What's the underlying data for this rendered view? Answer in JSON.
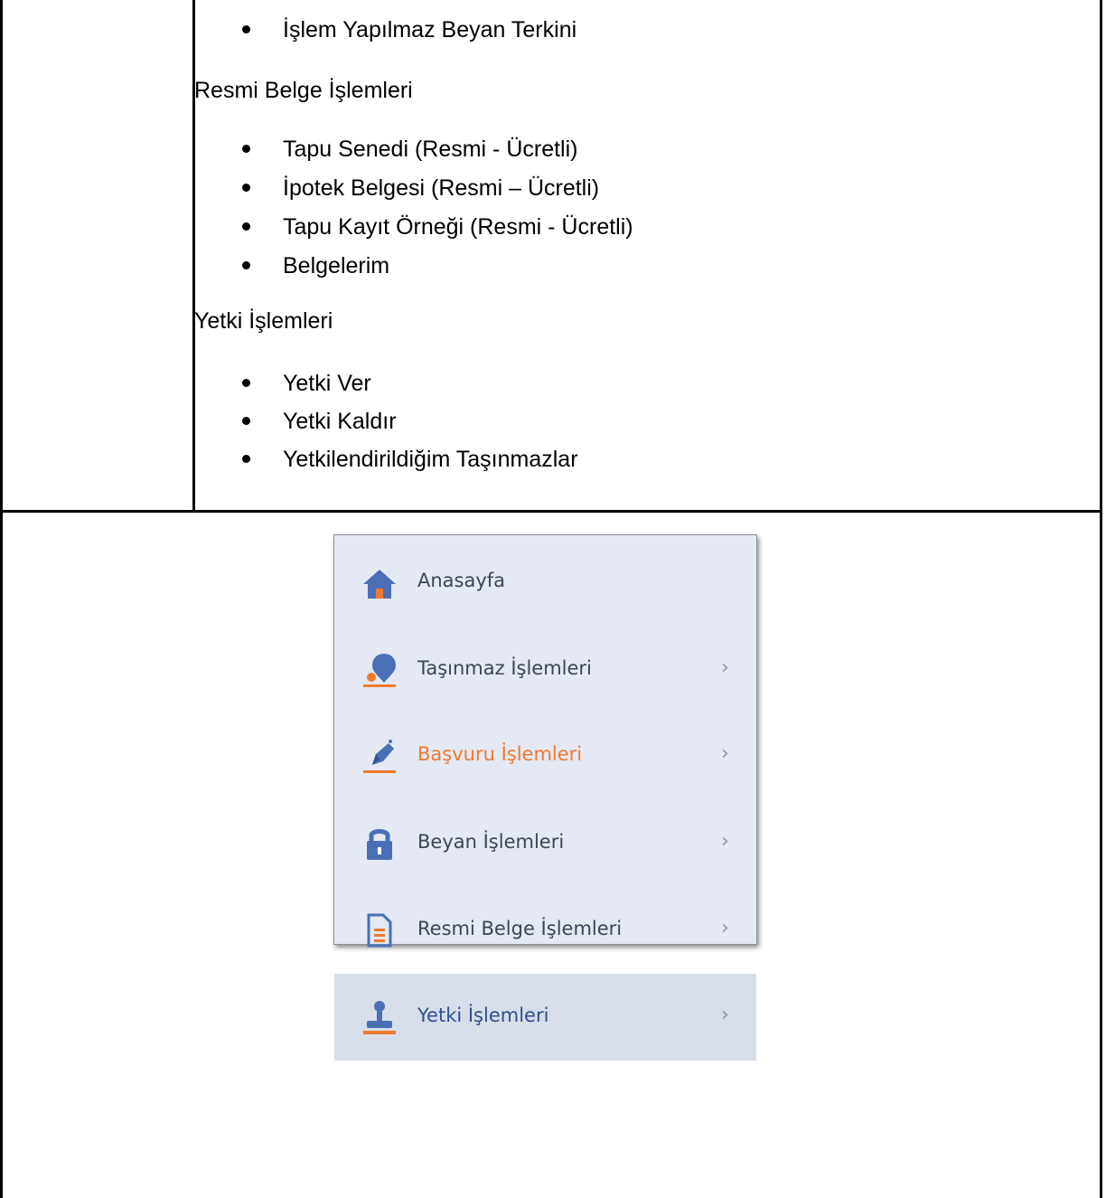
{
  "top_list": {
    "first_item": "İşlem Yapılmaz Beyan Terkini"
  },
  "resmi_belge": {
    "heading": "Resmi Belge İşlemleri",
    "items": [
      "Tapu Senedi (Resmi - Ücretli)",
      "İpotek Belgesi (Resmi – Ücretli)",
      "Tapu Kayıt Örneği (Resmi - Ücretli)",
      "Belgelerim"
    ]
  },
  "yetki": {
    "heading": "Yetki İşlemleri",
    "items": [
      "Yetki Ver",
      "Yetki Kaldır",
      "Yetkilendirildiğim Taşınmazlar"
    ]
  },
  "menu": {
    "chevron": "›",
    "items": [
      {
        "label": "Anasayfa",
        "icon": "home-icon"
      },
      {
        "label": "Taşınmaz İşlemleri",
        "icon": "map-pin-icon"
      },
      {
        "label": "Başvuru İşlemleri",
        "icon": "pen-icon"
      },
      {
        "label": "Beyan İşlemleri",
        "icon": "lock-icon"
      },
      {
        "label": "Resmi Belge İşlemleri",
        "icon": "document-icon"
      },
      {
        "label": "Yetki İşlemleri",
        "icon": "stamp-icon"
      }
    ]
  },
  "colors": {
    "icon_blue": "#4a6fb5",
    "accent_orange": "#ee7a2f",
    "menu_background": "#e4e9f3",
    "active_background": "#d8dee9"
  }
}
